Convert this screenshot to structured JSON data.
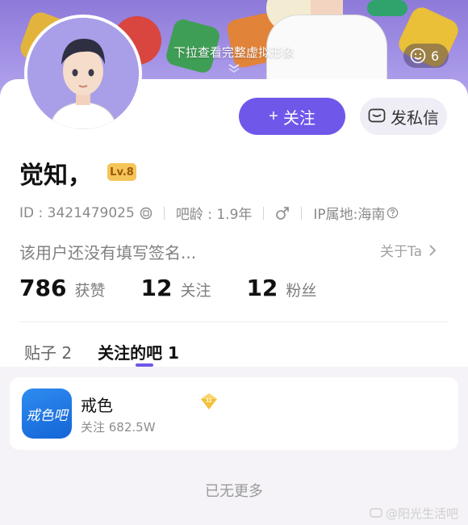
{
  "banner": {
    "hint": "下拉查看完整虚拟形象",
    "emoji_count": "6"
  },
  "profile": {
    "name": "觉知，",
    "level": "Lv.8",
    "id_label": "ID : 3421479025",
    "age_label": "吧龄 : 1.9年",
    "gender_icon": "male-symbol",
    "ip_label": "IP属地:海南",
    "signature": "该用户还没有填写签名...",
    "about": "关于Ta"
  },
  "actions": {
    "follow_icon": "+",
    "follow_label": "关注",
    "dm_label": "发私信"
  },
  "stats": [
    {
      "value": "786",
      "label": "获赞"
    },
    {
      "value": "12",
      "label": "关注"
    },
    {
      "value": "12",
      "label": "粉丝"
    }
  ],
  "tabs": [
    {
      "label": "贴子 2",
      "active": false
    },
    {
      "label": "关注的吧 1",
      "active": true
    }
  ],
  "forums": [
    {
      "icon_text": "戒色吧",
      "name": "戒色",
      "followers": "关注 682.5W",
      "badge": "11"
    }
  ],
  "footer": {
    "no_more": "已无更多",
    "watermark": "@阳光生活吧"
  },
  "colors": {
    "accent": "#6f57ea",
    "banner": "#a392e6",
    "level_bg": "#f5c55a"
  }
}
